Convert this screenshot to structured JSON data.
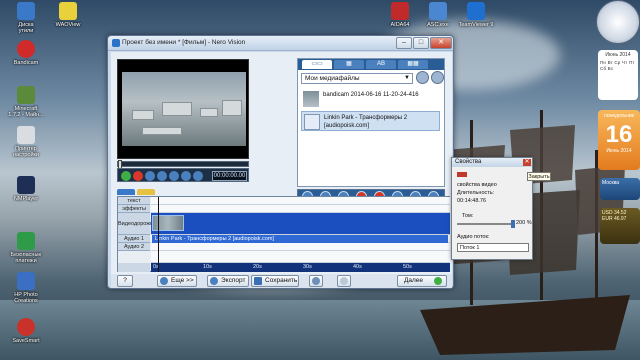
{
  "desktop": {
    "icons": [
      {
        "label": "Диска\nутили"
      },
      {
        "label": "WAOView"
      },
      {
        "label": "Bandicam"
      },
      {
        "label": "Minecraft\n1.7.2 - Майн..."
      },
      {
        "label": "Принтер\nнастройки"
      },
      {
        "label": "NMPlayer"
      },
      {
        "label": "Безопасные\nплатежи"
      },
      {
        "label": "HP Photo\nCreations"
      },
      {
        "label": "SaveSmart"
      },
      {
        "label": "AIDA64"
      },
      {
        "label": "ASC.exe"
      },
      {
        "label": "TeamViewer 9"
      }
    ]
  },
  "window": {
    "title": "Проект без имени * [Фильм] - Nero Vision",
    "buttons": {
      "minimize": "–",
      "maximize": "□",
      "close": "✕"
    }
  },
  "preview": {
    "timecode": "00:00:00.00"
  },
  "library": {
    "tabs": [
      "▭▭",
      "▦",
      "AB",
      "▦▦"
    ],
    "dropdown": "Мои медиафайлы",
    "items": [
      {
        "title": "bandicam 2014-06-16 11-20-24-416",
        "subtitle": ""
      },
      {
        "title": "Linkin Park - Трансформеры 2",
        "subtitle": "[audiopoisk.com]"
      }
    ]
  },
  "timeline": {
    "tracks": [
      "текст",
      "эффекты",
      "Видеодорожка",
      "Аудио 1",
      "Аудио 2"
    ],
    "audio_clip": "Linkin Park - Трансформеры 2 [audiopoisk.com]",
    "ruler_marks": [
      "0s",
      "10s",
      "20s",
      "30s",
      "40s",
      "50s"
    ]
  },
  "bottom_bar": {
    "help": "?",
    "more": "Еще >>",
    "export": "Экспорт",
    "save": "Сохранить",
    "next": "Далее"
  },
  "properties": {
    "title": "Свойства",
    "close_tooltip": "Закрыть",
    "type": "свойства видео",
    "duration_label": "Длительность:",
    "duration_value": "00:14:48.76",
    "volume_label": "Том:",
    "volume_value": "200 %",
    "audio_stream_label": "Аудио поток:",
    "audio_stream_value": "Поток 1"
  },
  "gadgets": {
    "calendar_header": "Июнь 2014",
    "calendar_days": "Пн Вт Ср Чт Пт Сб Вс",
    "date_day": "16",
    "date_weekday": "понедельник",
    "date_month": "Июнь 2014",
    "weather_text": "Москва",
    "currency_lines": [
      "USD 34.52",
      "EUR 46.97"
    ]
  },
  "volume_level_percent": 100
}
